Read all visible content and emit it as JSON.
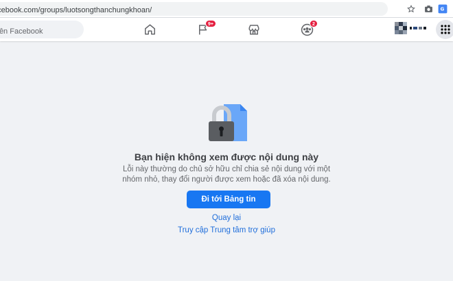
{
  "browser": {
    "url": "acebook.com/groups/luotsongthanchungkhoan/",
    "icons": [
      "star-icon",
      "camera-icon",
      "translate-icon"
    ]
  },
  "header": {
    "search_placeholder": "m trên Facebook",
    "nav": [
      {
        "name": "home-icon",
        "badge": ""
      },
      {
        "name": "pages-flag-icon",
        "badge": "9+"
      },
      {
        "name": "marketplace-icon",
        "badge": ""
      },
      {
        "name": "groups-icon",
        "badge": "2"
      }
    ],
    "menu_icon": "grid-menu-icon"
  },
  "error": {
    "illustration": "locked-document-icon",
    "title": "Bạn hiện không xem được nội dung này",
    "description_line1": "Lỗi này thường do chủ sở hữu chỉ chia sẻ nội dung với một",
    "description_line2": "nhóm nhỏ, thay đổi người được xem hoặc đã xóa nội dung.",
    "primary_button": "Đi tới Bảng tin",
    "back_link": "Quay lại",
    "help_link": "Truy cập Trung tâm trợ giúp"
  },
  "colors": {
    "primary": "#1877f2",
    "link": "#216fdb",
    "badge": "#e41e3f",
    "background": "#f0f2f5"
  }
}
